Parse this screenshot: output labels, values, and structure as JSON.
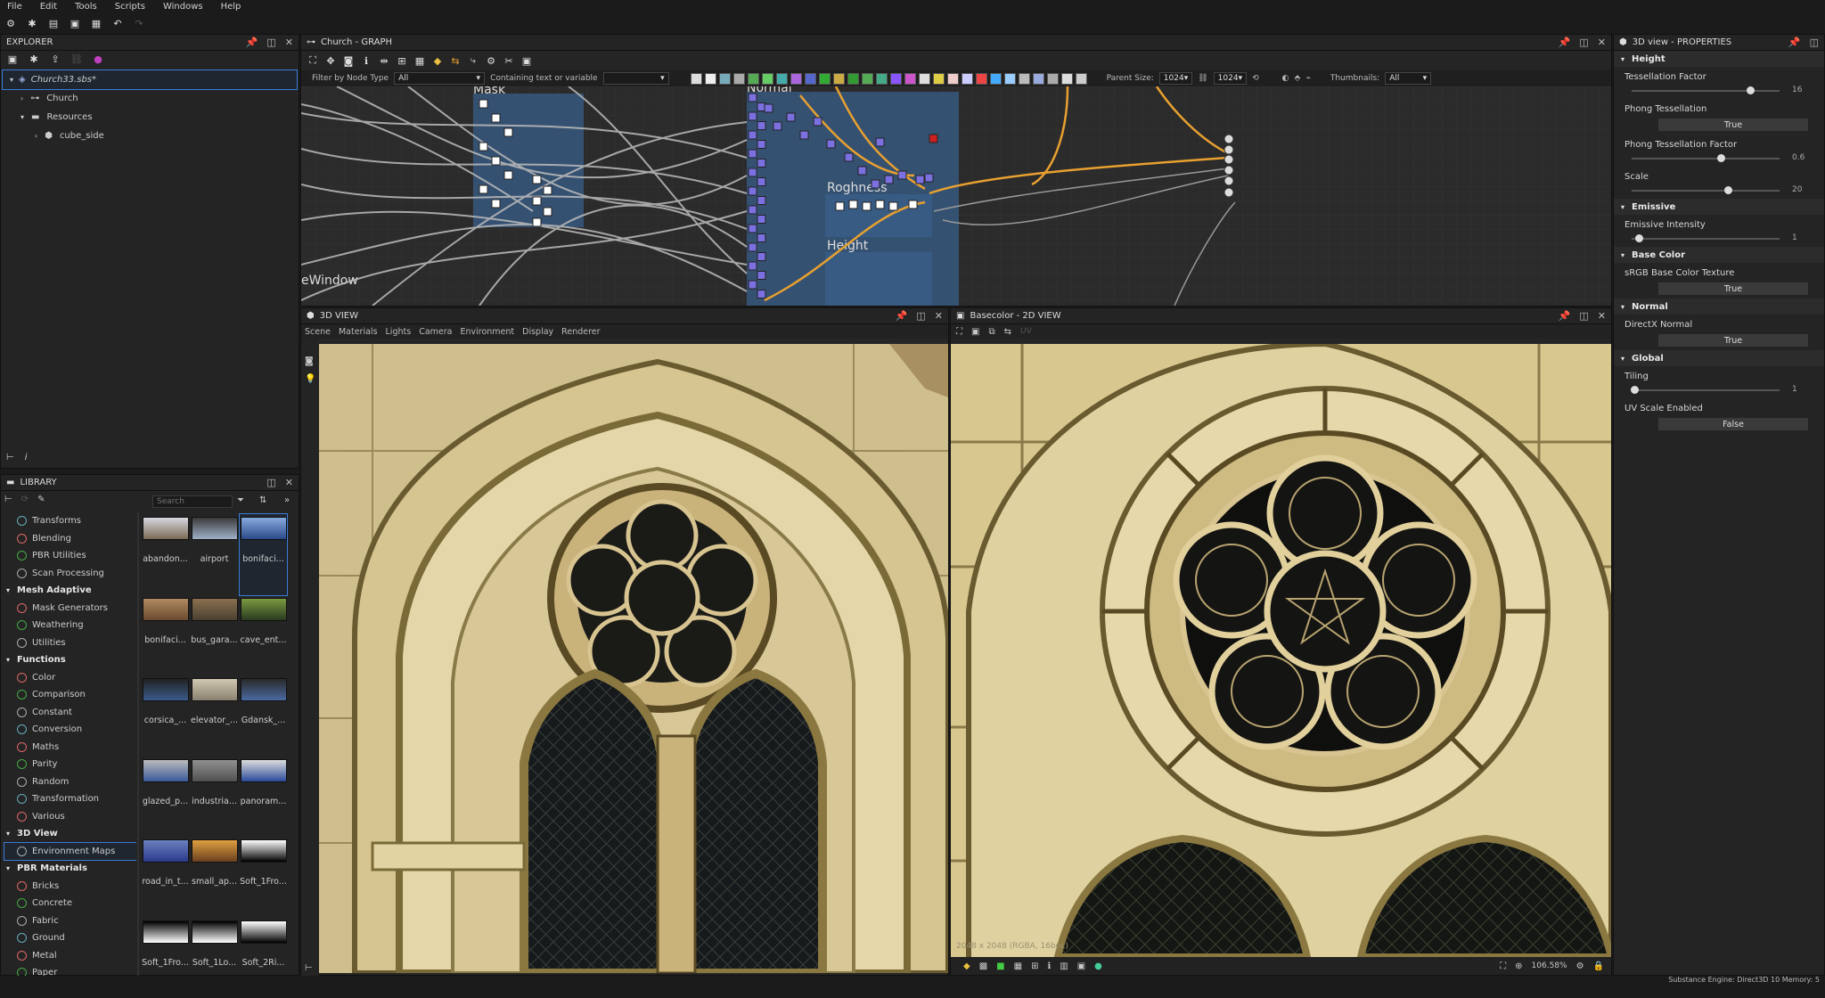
{
  "menu": [
    "File",
    "Edit",
    "Tools",
    "Scripts",
    "Windows",
    "Help"
  ],
  "explorer": {
    "title": "EXPLORER",
    "file": "Church33.sbs*",
    "items": [
      "Church",
      "Resources",
      "cube_side"
    ]
  },
  "library": {
    "title": "LIBRARY",
    "search_placeholder": "Search",
    "items": [
      {
        "label": "Transforms",
        "cat": false
      },
      {
        "label": "Blending",
        "cat": false
      },
      {
        "label": "PBR Utilities",
        "cat": false
      },
      {
        "label": "Scan Processing",
        "cat": false
      },
      {
        "label": "Mesh Adaptive",
        "cat": true
      },
      {
        "label": "Mask Generators",
        "cat": false
      },
      {
        "label": "Weathering",
        "cat": false
      },
      {
        "label": "Utilities",
        "cat": false
      },
      {
        "label": "Functions",
        "cat": true
      },
      {
        "label": "Color",
        "cat": false
      },
      {
        "label": "Comparison",
        "cat": false
      },
      {
        "label": "Constant",
        "cat": false
      },
      {
        "label": "Conversion",
        "cat": false
      },
      {
        "label": "Maths",
        "cat": false
      },
      {
        "label": "Parity",
        "cat": false
      },
      {
        "label": "Random",
        "cat": false
      },
      {
        "label": "Transformation",
        "cat": false
      },
      {
        "label": "Various",
        "cat": false
      },
      {
        "label": "3D View",
        "cat": true
      },
      {
        "label": "Environment Maps",
        "cat": false,
        "selected": true
      },
      {
        "label": "PBR Materials",
        "cat": true
      },
      {
        "label": "Bricks",
        "cat": false
      },
      {
        "label": "Concrete",
        "cat": false
      },
      {
        "label": "Fabric",
        "cat": false
      },
      {
        "label": "Ground",
        "cat": false
      },
      {
        "label": "Metal",
        "cat": false
      },
      {
        "label": "Paper",
        "cat": false
      }
    ],
    "thumbs": [
      {
        "cap": "abandon...",
        "c1": "#7a6a55",
        "c2": "#d8d8e0"
      },
      {
        "cap": "airport",
        "c1": "#9fb0c8",
        "c2": "#3a3a3a"
      },
      {
        "cap": "bonifaci...",
        "c1": "#2a4a8a",
        "c2": "#88aadd",
        "sel": true
      },
      {
        "cap": "bonifaci...",
        "c1": "#6a4a30",
        "c2": "#b08a60"
      },
      {
        "cap": "bus_gara...",
        "c1": "#4a4030",
        "c2": "#8a7050"
      },
      {
        "cap": "cave_ent...",
        "c1": "#2a3a20",
        "c2": "#7a9a40"
      },
      {
        "cap": "corsica_...",
        "c1": "#3a5a8a",
        "c2": "#222"
      },
      {
        "cap": "elevator_...",
        "c1": "#8a8070",
        "c2": "#d0c8b0"
      },
      {
        "cap": "Gdansk_...",
        "c1": "#4a6aa0",
        "c2": "#2a2a2a"
      },
      {
        "cap": "glazed_p...",
        "c1": "#3a5a9a",
        "c2": "#bbb"
      },
      {
        "cap": "industria...",
        "c1": "#505050",
        "c2": "#909090"
      },
      {
        "cap": "panoram...",
        "c1": "#2a4a9a",
        "c2": "#ddd"
      },
      {
        "cap": "road_in_t...",
        "c1": "#2a3a8a",
        "c2": "#6a80c0"
      },
      {
        "cap": "small_ap...",
        "c1": "#6a4020",
        "c2": "#e0a040"
      },
      {
        "cap": "Soft_1Fro...",
        "c1": "#000",
        "c2": "#fff"
      },
      {
        "cap": "Soft_1Fro...",
        "c1": "#fff",
        "c2": "#000"
      },
      {
        "cap": "Soft_1Lo...",
        "c1": "#fff",
        "c2": "#000"
      },
      {
        "cap": "Soft_2Ri...",
        "c1": "#000",
        "c2": "#fff"
      }
    ]
  },
  "graph": {
    "title": "Church - GRAPH",
    "filter_label": "Filter by Node Type",
    "filter_value": "All",
    "containing_label": "Containing text or variable",
    "parent_size_label": "Parent Size:",
    "parent_size_w": "1024",
    "parent_size_h": "1024",
    "thumbnails_label": "Thumbnails:",
    "thumbnails_value": "All",
    "frames": [
      "Mask",
      "Normal",
      "Roghness",
      "Height",
      "eWindow"
    ]
  },
  "view3d": {
    "title": "3D VIEW",
    "tabs": [
      "Scene",
      "Materials",
      "Lights",
      "Camera",
      "Environment",
      "Display",
      "Renderer"
    ]
  },
  "view2d": {
    "title": "Basecolor - 2D VIEW",
    "uv": "UV",
    "info": "2048 x 2048 (RGBA, 16bpc)",
    "zoom": "106.58%"
  },
  "properties": {
    "title": "3D view - PROPERTIES",
    "sections": [
      {
        "name": "Height",
        "rows": [
          {
            "label": "Tessellation Factor",
            "type": "slider",
            "pos": 0.8,
            "val": "16"
          },
          {
            "label": "Phong Tessellation",
            "type": "btn",
            "val": "True"
          },
          {
            "label": "Phong Tessellation Factor",
            "type": "slider",
            "pos": 0.6,
            "val": "0.6"
          },
          {
            "label": "Scale",
            "type": "slider",
            "pos": 0.65,
            "val": "20"
          }
        ]
      },
      {
        "name": "Emissive",
        "rows": [
          {
            "label": "Emissive Intensity",
            "type": "slider",
            "pos": 0.05,
            "val": "1"
          }
        ]
      },
      {
        "name": "Base Color",
        "rows": [
          {
            "label": "sRGB Base Color Texture",
            "type": "btn",
            "val": "True"
          }
        ]
      },
      {
        "name": "Normal",
        "rows": [
          {
            "label": "DirectX Normal",
            "type": "btn",
            "val": "True"
          }
        ]
      },
      {
        "name": "Global",
        "rows": [
          {
            "label": "Tiling",
            "type": "slider",
            "pos": 0.02,
            "val": "1"
          },
          {
            "label": "UV Scale Enabled",
            "type": "btn",
            "val": "False"
          }
        ]
      }
    ]
  },
  "status": "Substance Engine: Direct3D 10   Memory: 5"
}
